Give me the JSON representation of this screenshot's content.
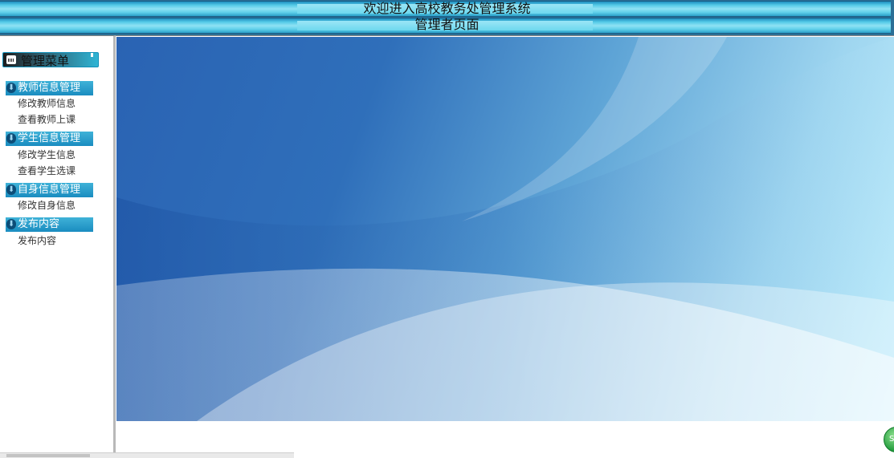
{
  "header": {
    "title": "欢迎进入高校教务处管理系统",
    "subtitle": "管理者页面"
  },
  "sidebar": {
    "menu_title": "管理菜单",
    "groups": [
      {
        "title": "教师信息管理",
        "items": [
          "修改教师信息",
          "查看教师上课"
        ]
      },
      {
        "title": "学生信息管理",
        "items": [
          "修改学生信息",
          "查看学生选课"
        ]
      },
      {
        "title": "自身信息管理",
        "items": [
          "修改自身信息"
        ]
      },
      {
        "title": "发布内容",
        "items": [
          "发布内容"
        ]
      }
    ]
  },
  "corner_button": {
    "label": "Se"
  },
  "colors": {
    "header_accent": "#55cbe8",
    "menu_group_bg": "#1a8cc0",
    "banner_dark": "#2a63b3",
    "banner_light": "#c2eefc"
  }
}
